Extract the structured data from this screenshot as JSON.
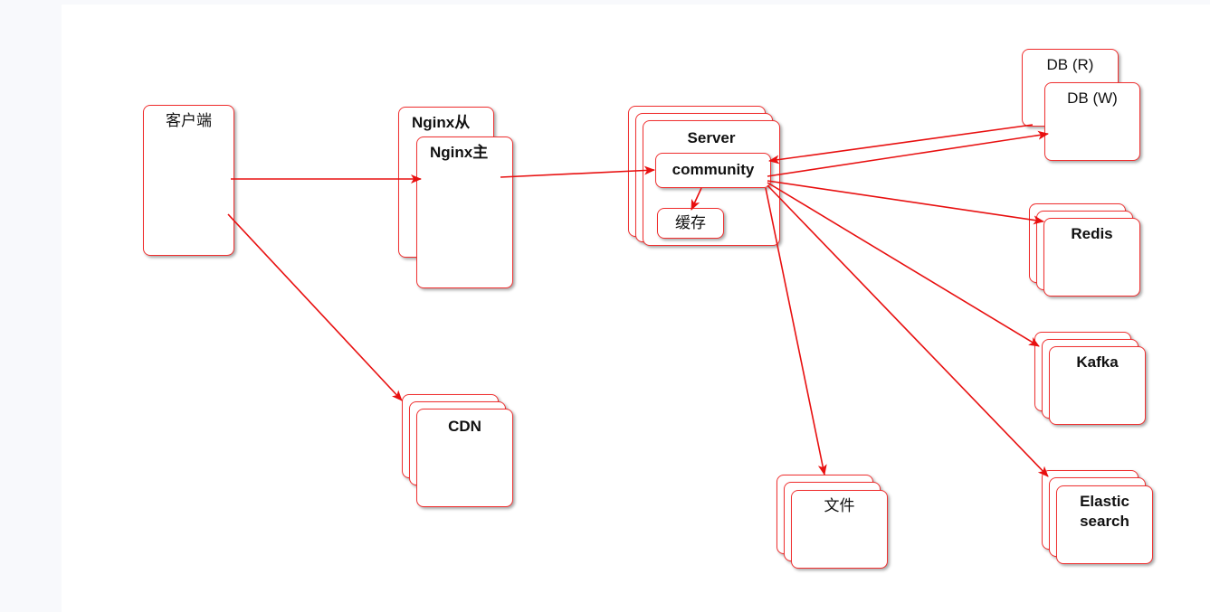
{
  "nodes": {
    "client": "客户端",
    "nginx_slave": "Nginx从",
    "nginx_master": "Nginx主",
    "server": "Server",
    "community": "community",
    "cache": "缓存",
    "db_read": "DB (R)",
    "db_write": "DB (W)",
    "redis": "Redis",
    "kafka": "Kafka",
    "elasticsearch": "Elastic search",
    "file": "文件",
    "cdn": "CDN"
  },
  "edges": [
    {
      "from": "client",
      "to": "nginx_master"
    },
    {
      "from": "client",
      "to": "cdn"
    },
    {
      "from": "nginx_master",
      "to": "community"
    },
    {
      "from": "community",
      "to": "cache"
    },
    {
      "from": "community",
      "to": "db_write"
    },
    {
      "from": "db_read",
      "to": "community"
    },
    {
      "from": "community",
      "to": "redis"
    },
    {
      "from": "community",
      "to": "kafka"
    },
    {
      "from": "community",
      "to": "elasticsearch"
    },
    {
      "from": "community",
      "to": "file"
    }
  ],
  "colors": {
    "stroke": "#f03030",
    "arrow": "#e81010",
    "text": "#111111"
  }
}
